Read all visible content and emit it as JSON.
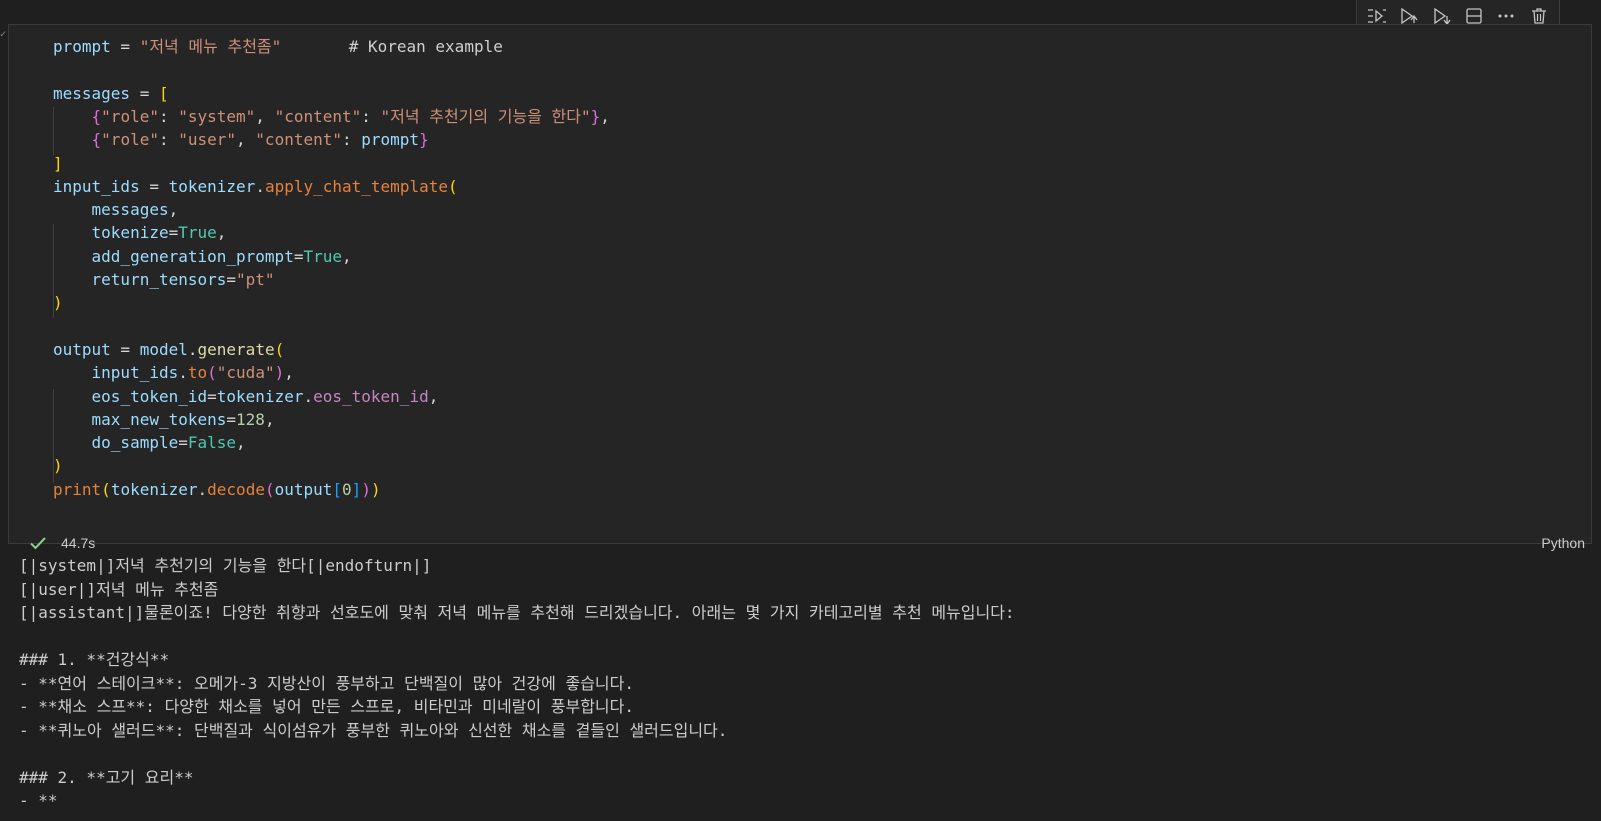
{
  "toolbar": {
    "items": [
      {
        "name": "execute-above-icon"
      },
      {
        "name": "run-above-icon"
      },
      {
        "name": "run-below-icon"
      },
      {
        "name": "split-cell-icon"
      },
      {
        "name": "more-icon"
      },
      {
        "name": "delete-icon"
      }
    ]
  },
  "code": {
    "lines": [
      [
        [
          "tok-var",
          "prompt"
        ],
        [
          "tok-op",
          " = "
        ],
        [
          "tok-str",
          "\"저녁 메뉴 추천좀\""
        ],
        [
          "tok-op",
          "       "
        ],
        [
          "tok-cm",
          "# Korean example"
        ]
      ],
      [],
      [
        [
          "tok-var",
          "messages"
        ],
        [
          "tok-op",
          " = "
        ],
        [
          "tok-br1",
          "["
        ]
      ],
      [
        [
          "tok-op",
          "    "
        ],
        [
          "tok-br2",
          "{"
        ],
        [
          "tok-str",
          "\"role\""
        ],
        [
          "tok-op",
          ": "
        ],
        [
          "tok-str",
          "\"system\""
        ],
        [
          "tok-op",
          ", "
        ],
        [
          "tok-str",
          "\"content\""
        ],
        [
          "tok-op",
          ": "
        ],
        [
          "tok-str",
          "\"저녁 추천기의 기능을 한다\""
        ],
        [
          "tok-br2",
          "}"
        ],
        [
          "tok-op",
          ","
        ]
      ],
      [
        [
          "tok-op",
          "    "
        ],
        [
          "tok-br2",
          "{"
        ],
        [
          "tok-str",
          "\"role\""
        ],
        [
          "tok-op",
          ": "
        ],
        [
          "tok-str",
          "\"user\""
        ],
        [
          "tok-op",
          ", "
        ],
        [
          "tok-str",
          "\"content\""
        ],
        [
          "tok-op",
          ": "
        ],
        [
          "tok-var",
          "prompt"
        ],
        [
          "tok-br2",
          "}"
        ]
      ],
      [
        [
          "tok-br1",
          "]"
        ]
      ],
      [
        [
          "tok-var",
          "input_ids"
        ],
        [
          "tok-op",
          " = "
        ],
        [
          "tok-var",
          "tokenizer"
        ],
        [
          "tok-op",
          "."
        ],
        [
          "tok-fn2",
          "apply_chat_template"
        ],
        [
          "tok-br1",
          "("
        ]
      ],
      [
        [
          "tok-op",
          "    "
        ],
        [
          "tok-var",
          "messages"
        ],
        [
          "tok-op",
          ","
        ]
      ],
      [
        [
          "tok-op",
          "    "
        ],
        [
          "tok-var",
          "tokenize"
        ],
        [
          "tok-op",
          "="
        ],
        [
          "tok-const",
          "True"
        ],
        [
          "tok-op",
          ","
        ]
      ],
      [
        [
          "tok-op",
          "    "
        ],
        [
          "tok-var",
          "add_generation_prompt"
        ],
        [
          "tok-op",
          "="
        ],
        [
          "tok-const",
          "True"
        ],
        [
          "tok-op",
          ","
        ]
      ],
      [
        [
          "tok-op",
          "    "
        ],
        [
          "tok-var",
          "return_tensors"
        ],
        [
          "tok-op",
          "="
        ],
        [
          "tok-str",
          "\"pt\""
        ]
      ],
      [
        [
          "tok-br1",
          ")"
        ]
      ],
      [],
      [
        [
          "tok-var",
          "output"
        ],
        [
          "tok-op",
          " = "
        ],
        [
          "tok-var",
          "model"
        ],
        [
          "tok-op",
          "."
        ],
        [
          "tok-fn",
          "generate"
        ],
        [
          "tok-br1",
          "("
        ]
      ],
      [
        [
          "tok-op",
          "    "
        ],
        [
          "tok-var",
          "input_ids"
        ],
        [
          "tok-op",
          "."
        ],
        [
          "tok-fn2",
          "to"
        ],
        [
          "tok-br2",
          "("
        ],
        [
          "tok-str",
          "\"cuda\""
        ],
        [
          "tok-br2",
          ")"
        ],
        [
          "tok-op",
          ","
        ]
      ],
      [
        [
          "tok-op",
          "    "
        ],
        [
          "tok-var",
          "eos_token_id"
        ],
        [
          "tok-op",
          "="
        ],
        [
          "tok-var",
          "tokenizer"
        ],
        [
          "tok-op",
          "."
        ],
        [
          "tok-prop",
          "eos_token_id"
        ],
        [
          "tok-op",
          ","
        ]
      ],
      [
        [
          "tok-op",
          "    "
        ],
        [
          "tok-var",
          "max_new_tokens"
        ],
        [
          "tok-op",
          "="
        ],
        [
          "tok-num",
          "128"
        ],
        [
          "tok-op",
          ","
        ]
      ],
      [
        [
          "tok-op",
          "    "
        ],
        [
          "tok-var",
          "do_sample"
        ],
        [
          "tok-op",
          "="
        ],
        [
          "tok-const",
          "False"
        ],
        [
          "tok-op",
          ","
        ]
      ],
      [
        [
          "tok-br1",
          ")"
        ]
      ],
      [
        [
          "tok-fn2",
          "print"
        ],
        [
          "tok-br1",
          "("
        ],
        [
          "tok-var",
          "tokenizer"
        ],
        [
          "tok-op",
          "."
        ],
        [
          "tok-fn2",
          "decode"
        ],
        [
          "tok-br2",
          "("
        ],
        [
          "tok-var",
          "output"
        ],
        [
          "tok-br3",
          "["
        ],
        [
          "tok-num",
          "0"
        ],
        [
          "tok-br3",
          "]"
        ],
        [
          "tok-br2",
          ")"
        ],
        [
          "tok-br1",
          ")"
        ]
      ]
    ]
  },
  "cell_status": {
    "time": "44.7s",
    "language": "Python"
  },
  "output": {
    "lines": [
      "[|system|]저녁 추천기의 기능을 한다[|endofturn|]",
      "[|user|]저녁 메뉴 추천좀",
      "[|assistant|]물론이죠! 다양한 취향과 선호도에 맞춰 저녁 메뉴를 추천해 드리겠습니다. 아래는 몇 가지 카테고리별 추천 메뉴입니다:",
      "",
      "### 1. **건강식**",
      "- **연어 스테이크**: 오메가-3 지방산이 풍부하고 단백질이 많아 건강에 좋습니다.",
      "- **채소 스프**: 다양한 채소를 넣어 만든 스프로, 비타민과 미네랄이 풍부합니다.",
      "- **퀴노아 샐러드**: 단백질과 식이섬유가 풍부한 퀴노아와 신선한 채소를 곁들인 샐러드입니다.",
      "",
      "### 2. **고기 요리**",
      "- **"
    ]
  }
}
